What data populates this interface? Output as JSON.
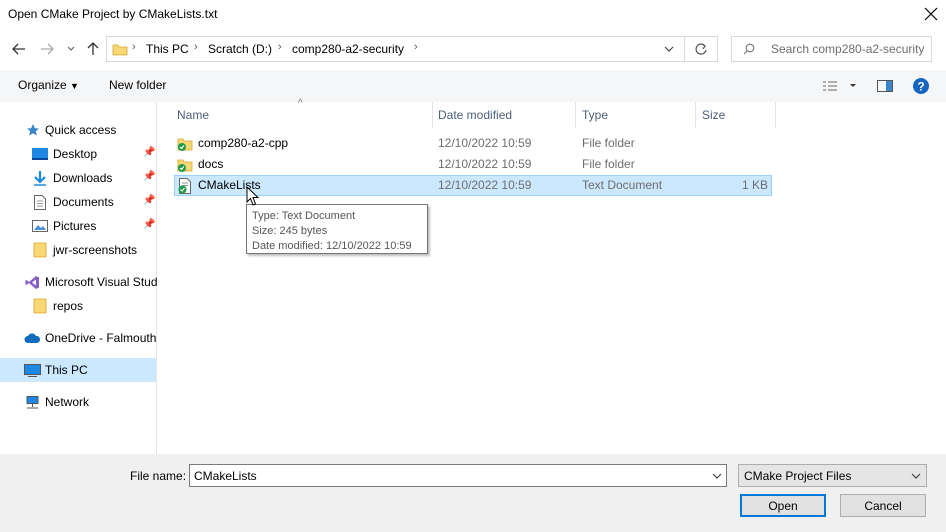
{
  "window": {
    "title": "Open CMake Project by CMakeLists.txt"
  },
  "address": {
    "crumbs": [
      "This PC",
      "Scratch (D:)",
      "comp280-a2-security"
    ],
    "search_placeholder": "Search comp280-a2-security"
  },
  "toolbar": {
    "organize": "Organize",
    "new_folder": "New folder"
  },
  "nav": {
    "quick_access": "Quick access",
    "items": [
      {
        "label": "Desktop",
        "icon": "desktop-icon",
        "pinned": true
      },
      {
        "label": "Downloads",
        "icon": "downloads-icon",
        "pinned": true
      },
      {
        "label": "Documents",
        "icon": "documents-icon",
        "pinned": true
      },
      {
        "label": "Pictures",
        "icon": "pictures-icon",
        "pinned": true
      },
      {
        "label": "jwr-screenshots",
        "icon": "folder-icon",
        "pinned": false
      }
    ],
    "visual_studio": "Microsoft Visual Stud",
    "repos": "repos",
    "onedrive": "OneDrive - Falmouth",
    "this_pc": "This PC",
    "network": "Network"
  },
  "columns": {
    "name": "Name",
    "date": "Date modified",
    "type": "Type",
    "size": "Size"
  },
  "files": [
    {
      "name": "comp280-a2-cpp",
      "date": "12/10/2022 10:59",
      "type": "File folder",
      "size": "",
      "icon": "folder-icon"
    },
    {
      "name": "docs",
      "date": "12/10/2022 10:59",
      "type": "File folder",
      "size": "",
      "icon": "folder-icon"
    },
    {
      "name": "CMakeLists",
      "date": "12/10/2022 10:59",
      "type": "Text Document",
      "size": "1 KB",
      "icon": "text-document-icon"
    }
  ],
  "tooltip": {
    "type": "Type: Text Document",
    "size": "Size: 245 bytes",
    "date": "Date modified: 12/10/2022 10:59"
  },
  "bottom": {
    "file_name_label": "File name:",
    "file_name_value": "CMakeLists",
    "file_type": "CMake Project Files",
    "open": "Open",
    "cancel": "Cancel"
  },
  "colors": {
    "selection": "#cce8ff",
    "accent": "#0078d7",
    "folder": "#f8d775"
  }
}
